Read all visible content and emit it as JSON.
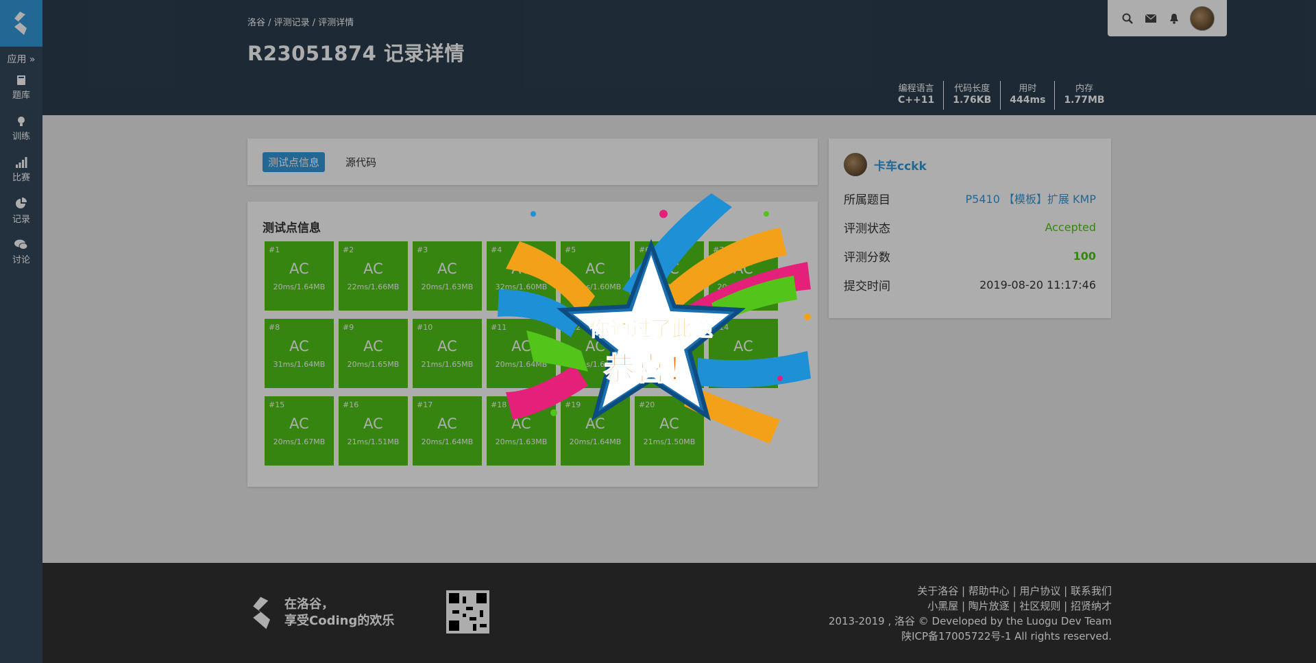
{
  "sidebar": {
    "apps_label": "应用 »",
    "items": [
      {
        "label": "题库",
        "icon": "book-icon"
      },
      {
        "label": "训练",
        "icon": "lightbulb-icon"
      },
      {
        "label": "比赛",
        "icon": "signal-icon"
      },
      {
        "label": "记录",
        "icon": "pie-chart-icon"
      },
      {
        "label": "讨论",
        "icon": "comments-icon"
      }
    ]
  },
  "header": {
    "breadcrumb": "洛谷 / 评测记录 / 评测详情",
    "title": "R23051874 记录详情",
    "stats": [
      {
        "label": "编程语言",
        "value": "C++11"
      },
      {
        "label": "代码长度",
        "value": "1.76KB"
      },
      {
        "label": "用时",
        "value": "444ms"
      },
      {
        "label": "内存",
        "value": "1.77MB"
      }
    ]
  },
  "topbar": {
    "icons": [
      "search-icon",
      "mail-icon",
      "bell-icon"
    ]
  },
  "tabs": [
    "测试点信息",
    "源代码"
  ],
  "testcases": {
    "title": "测试点信息",
    "cases": [
      {
        "id": "#1",
        "status": "AC",
        "detail": "20ms/1.64MB"
      },
      {
        "id": "#2",
        "status": "AC",
        "detail": "22ms/1.66MB"
      },
      {
        "id": "#3",
        "status": "AC",
        "detail": "20ms/1.63MB"
      },
      {
        "id": "#4",
        "status": "AC",
        "detail": "32ms/1.60MB"
      },
      {
        "id": "#5",
        "status": "AC",
        "detail": "21ms/1.60MB"
      },
      {
        "id": "#6",
        "status": "AC",
        "detail": "20ms/1.64MB"
      },
      {
        "id": "#7",
        "status": "AC",
        "detail": "20ms/1.64MB"
      },
      {
        "id": "#8",
        "status": "AC",
        "detail": "31ms/1.64MB"
      },
      {
        "id": "#9",
        "status": "AC",
        "detail": "20ms/1.65MB"
      },
      {
        "id": "#10",
        "status": "AC",
        "detail": "21ms/1.65MB"
      },
      {
        "id": "#11",
        "status": "AC",
        "detail": "20ms/1.64MB"
      },
      {
        "id": "#12",
        "status": "AC",
        "detail": "20ms/1.64MB"
      },
      {
        "id": "#13",
        "status": "AC",
        "detail": "20ms/1.64MB"
      },
      {
        "id": "#14",
        "status": "AC",
        "detail": "20ms/1.64MB"
      },
      {
        "id": "#15",
        "status": "AC",
        "detail": "20ms/1.67MB"
      },
      {
        "id": "#16",
        "status": "AC",
        "detail": "21ms/1.51MB"
      },
      {
        "id": "#17",
        "status": "AC",
        "detail": "20ms/1.64MB"
      },
      {
        "id": "#18",
        "status": "AC",
        "detail": "20ms/1.63MB"
      },
      {
        "id": "#19",
        "status": "AC",
        "detail": "20ms/1.64MB"
      },
      {
        "id": "#20",
        "status": "AC",
        "detail": "21ms/1.50MB"
      }
    ]
  },
  "info": {
    "username": "卡车cckk",
    "rows": [
      {
        "label": "所属题目",
        "value": "P5410 【模板】扩展 KMP",
        "color": "#3498db"
      },
      {
        "label": "评测状态",
        "value": "Accepted",
        "color": "#52c41a"
      },
      {
        "label": "评测分数",
        "value": "100",
        "color": "#52c41a"
      },
      {
        "label": "提交时间",
        "value": "2019-08-20 11:17:46",
        "color": "#333333"
      }
    ]
  },
  "popup": {
    "line1": "你通过了此题",
    "line2": "恭喜！"
  },
  "footer": {
    "slogan1": "在洛谷，",
    "slogan2": "享受Coding的欢乐",
    "links1": "关于洛谷 | 帮助中心 | 用户协议 | 联系我们",
    "links2": "小黑屋 | 陶片放逐 | 社区规则 | 招贤纳才",
    "copyright": "2013-2019 , 洛谷 © Developed by the Luogu Dev Team",
    "icp": "陕ICP备17005722号-1 All rights reserved."
  }
}
